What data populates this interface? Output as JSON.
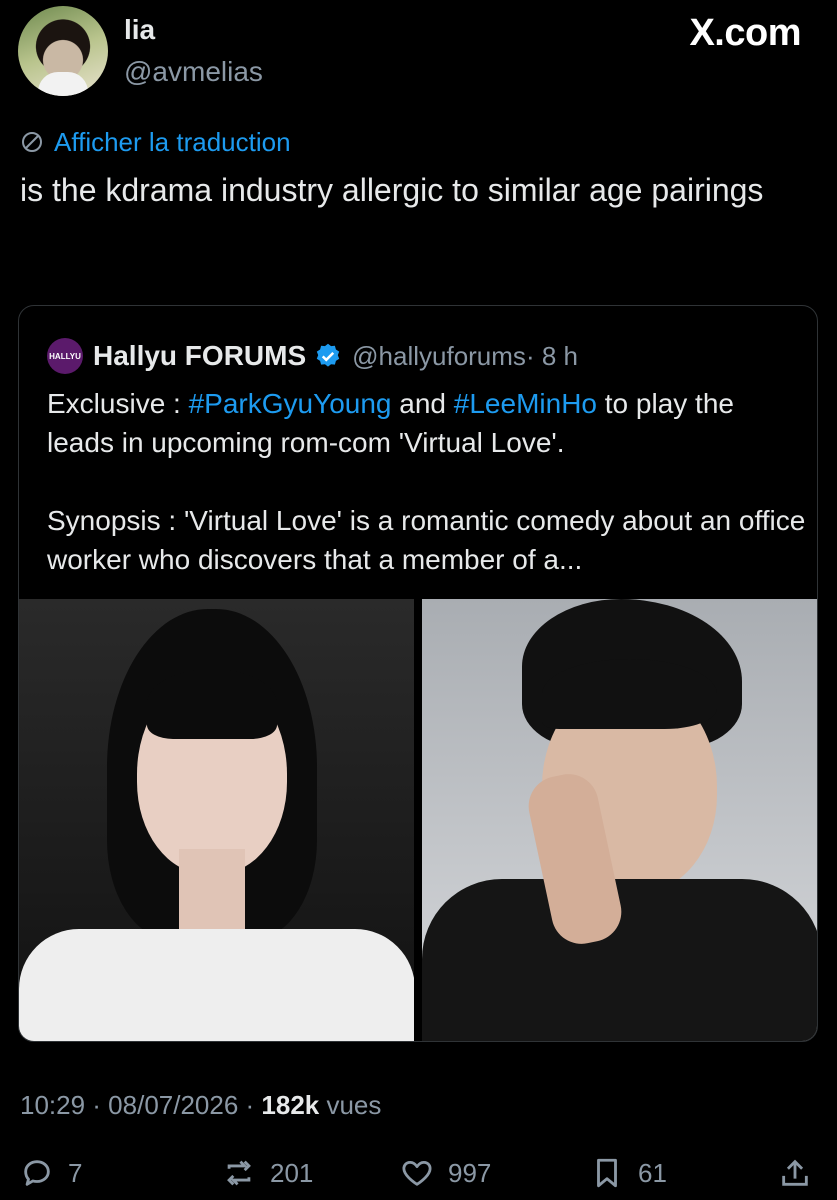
{
  "brand": {
    "site": "X.com"
  },
  "author": {
    "display_name": "lia",
    "handle": "@avmelias"
  },
  "translate": {
    "label": "Afficher la traduction",
    "icon": "globe-icon"
  },
  "tweet": {
    "text": "is the kdrama industry allergic to similar age pairings"
  },
  "quote": {
    "logo_text": "HALLYU",
    "display_name": "Hallyu FORUMS",
    "handle": "@hallyuforums",
    "time": "· 8 h",
    "line1_prefix": "Exclusive : ",
    "hashtag1": "#ParkGyuYoung",
    "line1_mid": " and ",
    "hashtag2": "#LeeMinHo",
    "line1_suffix": " to play the leads in upcoming rom-com 'Virtual Love'.",
    "synopsis": "Synopsis : 'Virtual Love' is a romantic comedy about an office worker who discovers that a member of a..."
  },
  "meta": {
    "time": "10:29 · 08/07/2026 · ",
    "views": "182k",
    "views_label": " vues"
  },
  "actions": {
    "replies": "7",
    "reposts": "201",
    "likes": "997",
    "bookmarks": "61"
  },
  "colors": {
    "accent": "#1d9bf0",
    "muted": "#8b98a5",
    "text": "#e7e9ea",
    "background": "#000000"
  }
}
